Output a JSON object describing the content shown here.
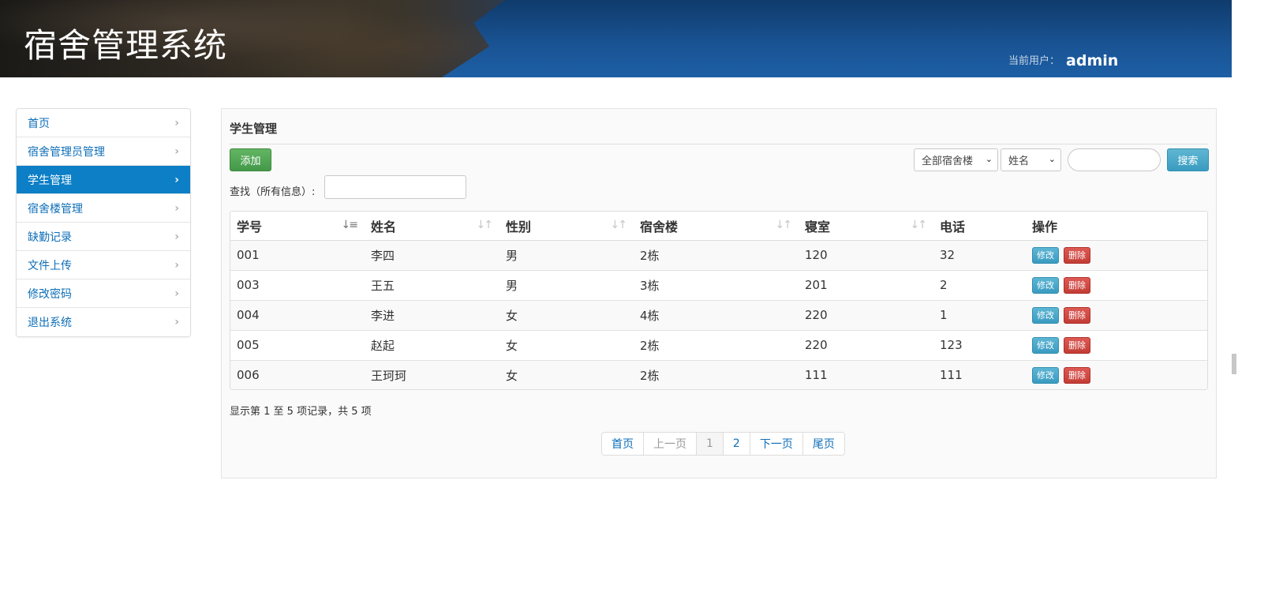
{
  "header": {
    "title": "宿舍管理系统",
    "current_user_label": "当前用户：",
    "current_user": "admin"
  },
  "sidebar": {
    "items": [
      {
        "label": "首页",
        "active": false
      },
      {
        "label": "宿舍管理员管理",
        "active": false
      },
      {
        "label": "学生管理",
        "active": true
      },
      {
        "label": "宿舍楼管理",
        "active": false
      },
      {
        "label": "缺勤记录",
        "active": false
      },
      {
        "label": "文件上传",
        "active": false
      },
      {
        "label": "修改密码",
        "active": false
      },
      {
        "label": "退出系统",
        "active": false
      }
    ]
  },
  "panel": {
    "title": "学生管理",
    "add_label": "添加",
    "building_select": "全部宿舍楼",
    "field_select": "姓名",
    "search_value": "",
    "search_label": "搜索",
    "find_label": "查找（所有信息）:",
    "find_value": ""
  },
  "table": {
    "columns": [
      "学号",
      "姓名",
      "性别",
      "宿舍楼",
      "寝室",
      "电话",
      "操作"
    ],
    "rows": [
      [
        "001",
        "李四",
        "男",
        "2栋",
        "120",
        "32"
      ],
      [
        "003",
        "王五",
        "男",
        "3栋",
        "201",
        "2"
      ],
      [
        "004",
        "李进",
        "女",
        "4栋",
        "220",
        "1"
      ],
      [
        "005",
        "赵起",
        "女",
        "2栋",
        "220",
        "123"
      ],
      [
        "006",
        "王珂珂",
        "女",
        "2栋",
        "111",
        "111"
      ]
    ],
    "edit_label": "修改",
    "delete_label": "删除"
  },
  "footer": {
    "records_info": "显示第 1 至 5 项记录，共 5 项",
    "pagination": [
      "首页",
      "上一页",
      "1",
      "2",
      "下一页",
      "尾页"
    ]
  },
  "colors": {
    "accent": "#0c7fc7",
    "add_button": "#4cae4c",
    "edit_button": "#46b8da",
    "delete_button": "#d43f3a"
  }
}
